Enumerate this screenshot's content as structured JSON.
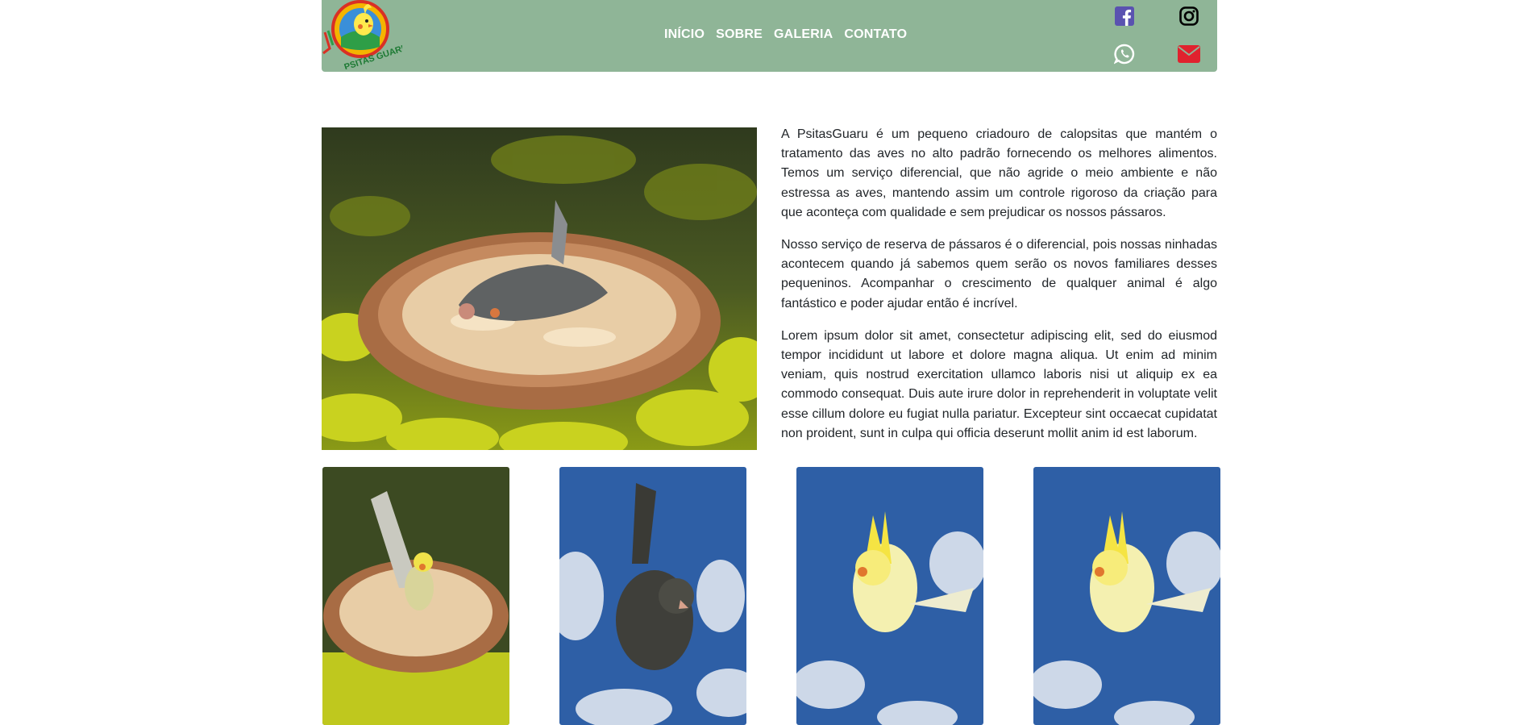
{
  "brand": {
    "logo_text": "PSITAS GUARU"
  },
  "nav": {
    "items": [
      {
        "label": "INÍCIO"
      },
      {
        "label": "SOBRE"
      },
      {
        "label": "GALERIA"
      },
      {
        "label": "CONTATO"
      }
    ]
  },
  "social": {
    "facebook": {
      "icon": "facebook-icon",
      "color": "#5a52b0"
    },
    "instagram": {
      "icon": "instagram-icon",
      "color": "#000000"
    },
    "whatsapp": {
      "icon": "whatsapp-icon",
      "color": "#ffffff"
    },
    "email": {
      "icon": "envelope-icon",
      "color": "#e0222e"
    }
  },
  "about": {
    "paragraphs": [
      "A PsitasGuaru é um pequeno criadouro de calopsitas que mantém o tratamento das aves no alto padrão fornecendo os melhores alimentos. Temos um serviço diferencial, que não agride o meio ambiente e não estressa as aves, mantendo assim um controle rigoroso da criação para que aconteça com qualidade e sem prejudicar os nossos pássaros.",
      "Nosso serviço de reserva de pássaros é o diferencial, pois nossas ninhadas acontecem quando já sabemos quem serão os novos familiares desses pequeninos. Acompanhar o crescimento de qualquer animal é algo fantástico e poder ajudar então é incrível.",
      "Lorem ipsum dolor sit amet, consectetur adipiscing elit, sed do eiusmod tempor incididunt ut labore et dolore magna aliqua. Ut enim ad minim veniam, quis nostrud exercitation ullamco laboris nisi ut aliquip ex ea commodo consequat. Duis aute irure dolor in reprehenderit in voluptate velit esse cillum dolore eu fugiat nulla pariatur. Excepteur sint occaecat cupidatat non proident, sunt in culpa qui officia deserunt mollit anim id est laborum."
    ]
  },
  "colors": {
    "navbar": "#8fb597",
    "nav_text": "#ffffff",
    "body_text": "#212529"
  }
}
